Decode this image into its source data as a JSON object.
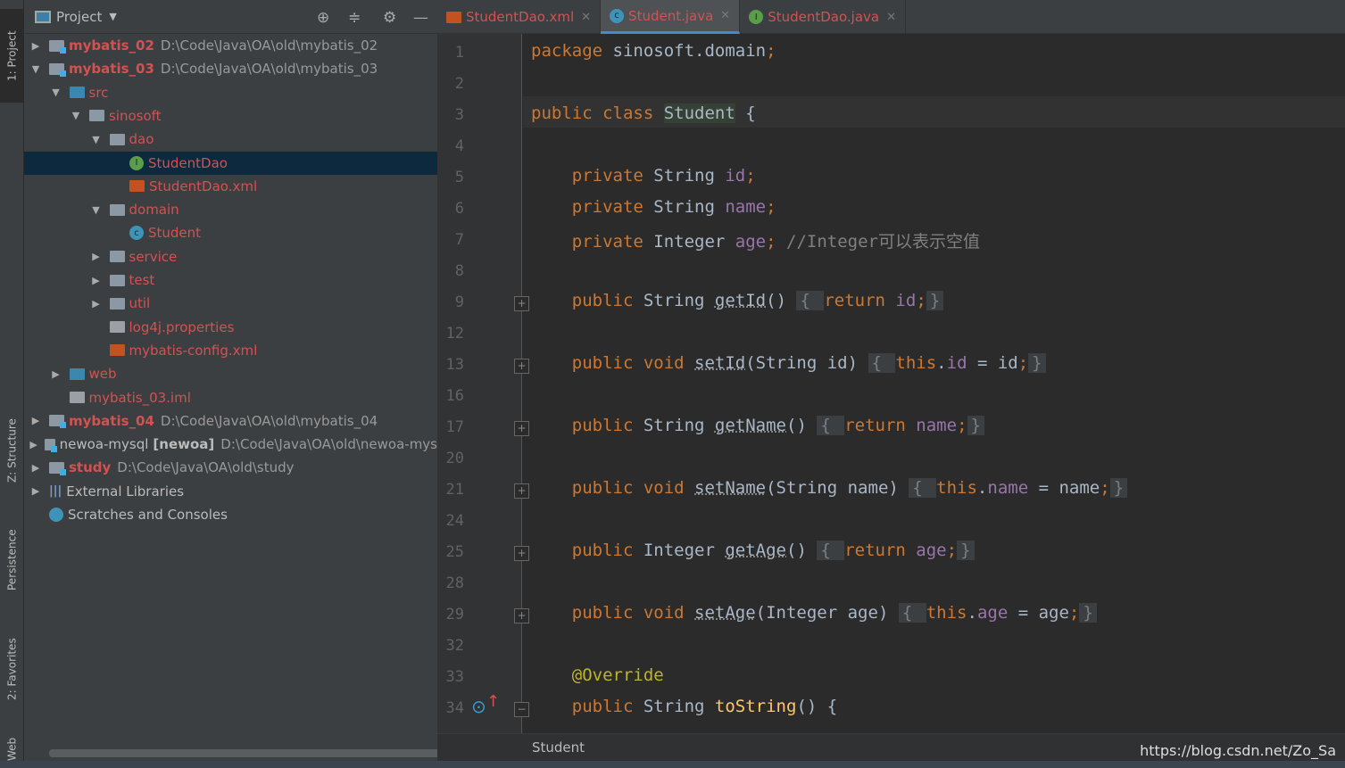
{
  "side_tabs": [
    "1: Project",
    "Z: Structure",
    "Persistence",
    "2: Favorites",
    "Web"
  ],
  "project": {
    "title": "Project",
    "rows": [
      {
        "label": "mybatis_02",
        "path": "D:\\Code\\Java\\OA\\old\\mybatis_02",
        "icon": "module",
        "indent": 0,
        "twist": "collapsed",
        "style": "red-bold"
      },
      {
        "label": "mybatis_03",
        "path": "D:\\Code\\Java\\OA\\old\\mybatis_03",
        "icon": "module",
        "indent": 0,
        "twist": "expanded",
        "style": "red-bold"
      },
      {
        "label": "src",
        "icon": "source-folder",
        "indent": 1,
        "twist": "expanded",
        "style": "red"
      },
      {
        "label": "sinosoft",
        "icon": "package",
        "indent": 2,
        "twist": "expanded",
        "style": "red"
      },
      {
        "label": "dao",
        "icon": "package",
        "indent": 3,
        "twist": "expanded",
        "style": "red"
      },
      {
        "label": "StudentDao",
        "icon": "interface",
        "indent": 4,
        "twist": "",
        "style": "red",
        "selected": true
      },
      {
        "label": "StudentDao.xml",
        "icon": "xml",
        "indent": 4,
        "twist": "",
        "style": "red"
      },
      {
        "label": "domain",
        "icon": "package",
        "indent": 3,
        "twist": "expanded",
        "style": "red"
      },
      {
        "label": "Student",
        "icon": "class",
        "indent": 4,
        "twist": "",
        "style": "red"
      },
      {
        "label": "service",
        "icon": "package",
        "indent": 3,
        "twist": "collapsed",
        "style": "red"
      },
      {
        "label": "test",
        "icon": "package",
        "indent": 3,
        "twist": "collapsed",
        "style": "red"
      },
      {
        "label": "util",
        "icon": "package",
        "indent": 3,
        "twist": "collapsed",
        "style": "red"
      },
      {
        "label": "log4j.properties",
        "icon": "properties",
        "indent": 3,
        "twist": "",
        "style": "red"
      },
      {
        "label": "mybatis-config.xml",
        "icon": "xml",
        "indent": 3,
        "twist": "",
        "style": "red"
      },
      {
        "label": "web",
        "icon": "web-folder",
        "indent": 1,
        "twist": "collapsed",
        "style": "red"
      },
      {
        "label": "mybatis_03.iml",
        "icon": "iml",
        "indent": 1,
        "twist": "",
        "style": "red"
      },
      {
        "label": "mybatis_04",
        "path": "D:\\Code\\Java\\OA\\old\\mybatis_04",
        "icon": "module",
        "indent": 0,
        "twist": "collapsed",
        "style": "red-bold"
      },
      {
        "label": "newoa-mysql",
        "extra": "[newoa]",
        "path": "D:\\Code\\Java\\OA\\old\\newoa-mys",
        "icon": "module",
        "indent": 0,
        "twist": "collapsed",
        "style": "normal"
      },
      {
        "label": "study",
        "path": "D:\\Code\\Java\\OA\\old\\study",
        "icon": "module",
        "indent": 0,
        "twist": "collapsed",
        "style": "red-bold"
      },
      {
        "label": "External Libraries",
        "icon": "libraries",
        "indent": 0,
        "twist": "collapsed",
        "style": "normal"
      },
      {
        "label": "Scratches and Consoles",
        "icon": "scratches",
        "indent": 0,
        "twist": "",
        "style": "normal"
      }
    ]
  },
  "tabs": [
    {
      "label": "StudentDao.xml",
      "icon": "xml",
      "active": false
    },
    {
      "label": "Student.java",
      "icon": "class",
      "active": true
    },
    {
      "label": "StudentDao.java",
      "icon": "interface",
      "active": false
    }
  ],
  "code": [
    {
      "n": "1",
      "fold": "",
      "t": [
        [
          "package ",
          "k"
        ],
        [
          "sinosoft.domain",
          ""
        ],
        [
          ";",
          "k"
        ]
      ]
    },
    {
      "n": "2",
      "fold": "",
      "t": []
    },
    {
      "n": "3",
      "fold": "",
      "t": [
        [
          "public class ",
          "k"
        ],
        [
          "Student",
          "hl"
        ],
        [
          " {",
          ""
        ]
      ]
    },
    {
      "n": "4",
      "fold": "",
      "t": []
    },
    {
      "n": "5",
      "fold": "",
      "t": [
        [
          "    private ",
          "k"
        ],
        [
          "String ",
          ""
        ],
        [
          "id",
          "f"
        ],
        [
          ";",
          "k"
        ]
      ]
    },
    {
      "n": "6",
      "fold": "",
      "t": [
        [
          "    private ",
          "k"
        ],
        [
          "String ",
          ""
        ],
        [
          "name",
          "f"
        ],
        [
          ";",
          "k"
        ]
      ]
    },
    {
      "n": "7",
      "fold": "",
      "t": [
        [
          "    private ",
          "k"
        ],
        [
          "Integer ",
          ""
        ],
        [
          "age",
          "f"
        ],
        [
          "; ",
          "k"
        ],
        [
          "//Integer可以表示空值",
          "c"
        ]
      ]
    },
    {
      "n": "8",
      "fold": "",
      "t": []
    },
    {
      "n": "9",
      "fold": "+",
      "t": [
        [
          "    public ",
          "k"
        ],
        [
          "String ",
          ""
        ],
        [
          "getId",
          "u"
        ],
        [
          "() ",
          ""
        ],
        [
          "{ ",
          "fb"
        ],
        [
          "return ",
          "k"
        ],
        [
          "id",
          "f"
        ],
        [
          ";",
          "k"
        ],
        [
          "}",
          "fb"
        ]
      ]
    },
    {
      "n": "12",
      "fold": "",
      "t": []
    },
    {
      "n": "13",
      "fold": "+",
      "t": [
        [
          "    public void ",
          "k"
        ],
        [
          "setId",
          "u"
        ],
        [
          "(String id) ",
          ""
        ],
        [
          "{ ",
          "fb"
        ],
        [
          "this",
          "k"
        ],
        [
          ".",
          ""
        ],
        [
          "id",
          "f"
        ],
        [
          " = id",
          ""
        ],
        [
          ";",
          "k"
        ],
        [
          "}",
          "fb"
        ]
      ]
    },
    {
      "n": "16",
      "fold": "",
      "t": []
    },
    {
      "n": "17",
      "fold": "+",
      "t": [
        [
          "    public ",
          "k"
        ],
        [
          "String ",
          ""
        ],
        [
          "getName",
          "u"
        ],
        [
          "() ",
          ""
        ],
        [
          "{ ",
          "fb"
        ],
        [
          "return ",
          "k"
        ],
        [
          "name",
          "f"
        ],
        [
          ";",
          "k"
        ],
        [
          "}",
          "fb"
        ]
      ]
    },
    {
      "n": "20",
      "fold": "",
      "t": []
    },
    {
      "n": "21",
      "fold": "+",
      "t": [
        [
          "    public void ",
          "k"
        ],
        [
          "setName",
          "u"
        ],
        [
          "(String name) ",
          ""
        ],
        [
          "{ ",
          "fb"
        ],
        [
          "this",
          "k"
        ],
        [
          ".",
          ""
        ],
        [
          "name",
          "f"
        ],
        [
          " = name",
          ""
        ],
        [
          ";",
          "k"
        ],
        [
          "}",
          "fb"
        ]
      ]
    },
    {
      "n": "24",
      "fold": "",
      "t": []
    },
    {
      "n": "25",
      "fold": "+",
      "t": [
        [
          "    public ",
          "k"
        ],
        [
          "Integer ",
          ""
        ],
        [
          "getAge",
          "u"
        ],
        [
          "() ",
          ""
        ],
        [
          "{ ",
          "fb"
        ],
        [
          "return ",
          "k"
        ],
        [
          "age",
          "f"
        ],
        [
          ";",
          "k"
        ],
        [
          "}",
          "fb"
        ]
      ]
    },
    {
      "n": "28",
      "fold": "",
      "t": []
    },
    {
      "n": "29",
      "fold": "+",
      "t": [
        [
          "    public void ",
          "k"
        ],
        [
          "setAge",
          "u"
        ],
        [
          "(Integer age) ",
          ""
        ],
        [
          "{ ",
          "fb"
        ],
        [
          "this",
          "k"
        ],
        [
          ".",
          ""
        ],
        [
          "age",
          "f"
        ],
        [
          " = age",
          ""
        ],
        [
          ";",
          "k"
        ],
        [
          "}",
          "fb"
        ]
      ]
    },
    {
      "n": "32",
      "fold": "",
      "t": []
    },
    {
      "n": "33",
      "fold": "",
      "t": [
        [
          "    @Override",
          "a"
        ]
      ]
    },
    {
      "n": "34",
      "fold": "-",
      "t": [
        [
          "    public ",
          "k"
        ],
        [
          "String ",
          ""
        ],
        [
          "toString",
          "m"
        ],
        [
          "() {",
          ""
        ]
      ]
    }
  ],
  "breadcrumb": "Student",
  "watermark": "https://blog.csdn.net/Zo_Sa",
  "colors": {
    "keyword": "#cc7832",
    "field": "#9876aa",
    "method": "#ffc66d",
    "comment": "#808080",
    "annotation": "#bbb529",
    "vcs_modified": "#d25252"
  }
}
